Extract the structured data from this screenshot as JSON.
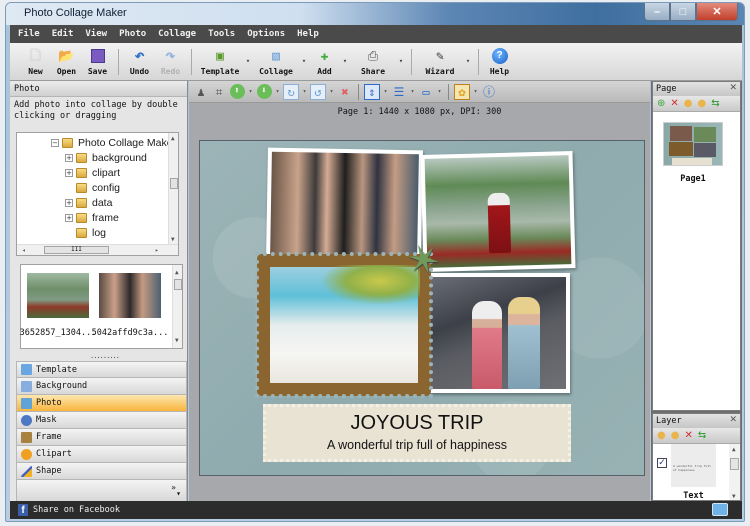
{
  "window": {
    "title": "Photo Collage Maker",
    "controls": {
      "minimize": "–",
      "maximize": "□",
      "close": "✕"
    }
  },
  "menu": [
    "File",
    "Edit",
    "View",
    "Photo",
    "Collage",
    "Tools",
    "Options",
    "Help"
  ],
  "toolbar": {
    "items": [
      {
        "label": "New",
        "icon": "new-document-icon",
        "glyph": "🗋"
      },
      {
        "label": "Open",
        "icon": "open-folder-icon",
        "glyph": "📂"
      },
      {
        "label": "Save",
        "icon": "save-disk-icon",
        "glyph": "💾"
      },
      {
        "label": "Undo",
        "icon": "undo-icon",
        "glyph": "↶"
      },
      {
        "label": "Redo",
        "icon": "redo-icon",
        "glyph": "↷",
        "disabled": true
      },
      {
        "label": "Template",
        "icon": "template-icon",
        "glyph": "▣"
      },
      {
        "label": "Collage",
        "icon": "collage-icon",
        "glyph": "▧"
      },
      {
        "label": "Add",
        "icon": "add-photo-icon",
        "glyph": "✚"
      },
      {
        "label": "Share",
        "icon": "printer-share-icon",
        "glyph": "⎙"
      },
      {
        "label": "Wizard",
        "icon": "magic-wand-icon",
        "glyph": "✎"
      },
      {
        "label": "Help",
        "icon": "help-icon",
        "glyph": "?"
      }
    ]
  },
  "left_panel": {
    "header": "Photo",
    "description": "Add photo into collage by double clicking or dragging",
    "tree": [
      {
        "label": "Photo Collage Make",
        "expand": "−",
        "level": 0
      },
      {
        "label": "background",
        "expand": "+",
        "level": 1
      },
      {
        "label": "clipart",
        "expand": "+",
        "level": 1
      },
      {
        "label": "config",
        "expand": "",
        "level": 1
      },
      {
        "label": "data",
        "expand": "+",
        "level": 1
      },
      {
        "label": "frame",
        "expand": "+",
        "level": 1
      },
      {
        "label": "log",
        "expand": "",
        "level": 1
      }
    ],
    "hscroll_grip": "III",
    "thumbnails": [
      {
        "caption": "3652857_1304..."
      },
      {
        "caption": "5042affd9c3a..."
      }
    ],
    "splitter_grip": "·········",
    "categories": [
      {
        "label": "Template",
        "color": "#6aa6e0"
      },
      {
        "label": "Background",
        "color": "#88aee0"
      },
      {
        "label": "Photo",
        "color": "#5fa3d8",
        "active": true
      },
      {
        "label": "Mask",
        "color": "#4a78c2"
      },
      {
        "label": "Frame",
        "color": "#a8823e"
      },
      {
        "label": "Clipart",
        "color": "#f0a020"
      },
      {
        "label": "Shape",
        "color": "#4060c0"
      }
    ],
    "more": "»"
  },
  "canvas_toolbar": {
    "icons": [
      {
        "name": "person-icon",
        "glyph": "♟"
      },
      {
        "name": "crop-icon",
        "glyph": "⌗"
      },
      {
        "name": "bring-forward-icon",
        "glyph": "⬆",
        "dropdown": true
      },
      {
        "name": "send-backward-icon",
        "glyph": "⬇",
        "dropdown": true
      },
      {
        "name": "rotate-right-icon",
        "glyph": "↻",
        "dropdown": true
      },
      {
        "name": "rotate-left-icon",
        "glyph": "↺",
        "dropdown": true
      },
      {
        "name": "delete-icon",
        "glyph": "✖"
      },
      {
        "name": "align-center-icon",
        "glyph": "⇕",
        "dropdown": true,
        "sep_before": true
      },
      {
        "name": "align-left-icon",
        "glyph": "☰",
        "dropdown": true
      },
      {
        "name": "distribute-icon",
        "glyph": "▭",
        "dropdown": true
      },
      {
        "name": "replace-image-icon",
        "glyph": "✿",
        "dropdown": true,
        "sep_before": true
      },
      {
        "name": "properties-icon",
        "glyph": "ⓘ"
      }
    ]
  },
  "page_info": "Page 1: 1440 x 1080 px, DPI: 300",
  "collage": {
    "title": "JOYOUS TRIP",
    "subtitle": "A wonderful trip full of happiness"
  },
  "page_panel": {
    "header": "Page",
    "close": "✕",
    "tools": [
      {
        "name": "add-page-icon",
        "glyph": "⊕",
        "color": "#3faa3f"
      },
      {
        "name": "delete-page-icon",
        "glyph": "✕",
        "color": "#d03030"
      },
      {
        "name": "move-up-icon",
        "glyph": "●",
        "color": "#e9b44c"
      },
      {
        "name": "move-down-icon",
        "glyph": "●",
        "color": "#e9b44c"
      },
      {
        "name": "swap-icon",
        "glyph": "⇆",
        "color": "#2a9a2a"
      }
    ],
    "pages": [
      {
        "label": "Page1"
      }
    ]
  },
  "layer_panel": {
    "header": "Layer",
    "close": "✕",
    "tools": [
      {
        "name": "layer-up-icon",
        "glyph": "●",
        "color": "#e9b44c"
      },
      {
        "name": "layer-down-icon",
        "glyph": "●",
        "color": "#e9b44c"
      },
      {
        "name": "delete-layer-icon",
        "glyph": "✕",
        "color": "#d03030"
      },
      {
        "name": "swap-layer-icon",
        "glyph": "⇆",
        "color": "#2a9a2a"
      }
    ],
    "layers": [
      {
        "label": "Text",
        "checked": true,
        "preview": "A wonderful trip full of happiness"
      }
    ]
  },
  "statusbar": {
    "share_label": "Share on Facebook"
  }
}
